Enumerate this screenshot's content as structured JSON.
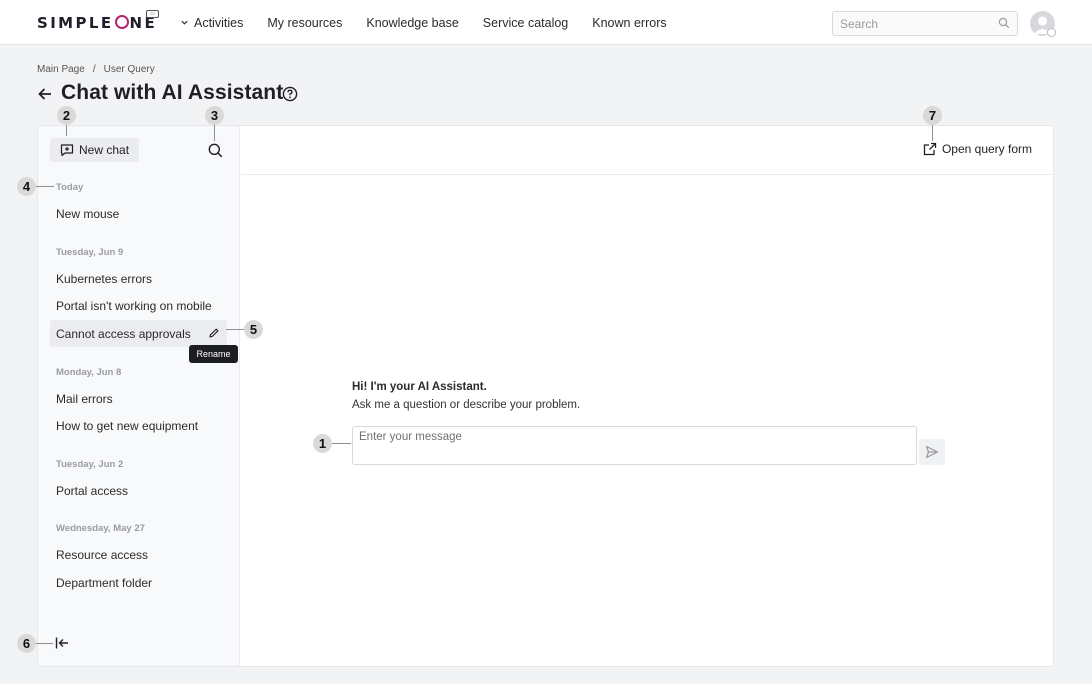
{
  "header": {
    "logo": "SIMPLEONE",
    "nav": [
      "Activities",
      "My resources",
      "Knowledge base",
      "Service catalog",
      "Known errors"
    ],
    "search_placeholder": "Search"
  },
  "breadcrumb": [
    "Main Page",
    "/",
    "User Query"
  ],
  "page_title": "Chat with AI Assistant",
  "sidebar": {
    "new_chat_label": "New chat",
    "groups": [
      {
        "label": "Today",
        "items": [
          "New mouse"
        ]
      },
      {
        "label": "Tuesday, Jun 9",
        "items": [
          "Kubernetes errors",
          "Portal isn't working on mobile",
          "Cannot access approvals"
        ]
      },
      {
        "label": "Monday, Jun 8",
        "items": [
          "Mail errors",
          "How to get new equipment"
        ]
      },
      {
        "label": "Tuesday, Jun 2",
        "items": [
          "Portal access"
        ]
      },
      {
        "label": "Wednesday, May 27",
        "items": [
          "Resource access",
          "Department folder"
        ]
      }
    ],
    "tooltip": "Rename"
  },
  "chat": {
    "open_query_label": "Open query form",
    "greeting_title": "Hi! I'm your AI Assistant.",
    "greeting_sub": "Ask me a question or describe your problem.",
    "message_placeholder": "Enter your message"
  },
  "callouts": [
    "1",
    "2",
    "3",
    "4",
    "5",
    "6",
    "7"
  ],
  "colors": {
    "accent": "#b5246e",
    "page_bg": "#f2f3f5"
  }
}
